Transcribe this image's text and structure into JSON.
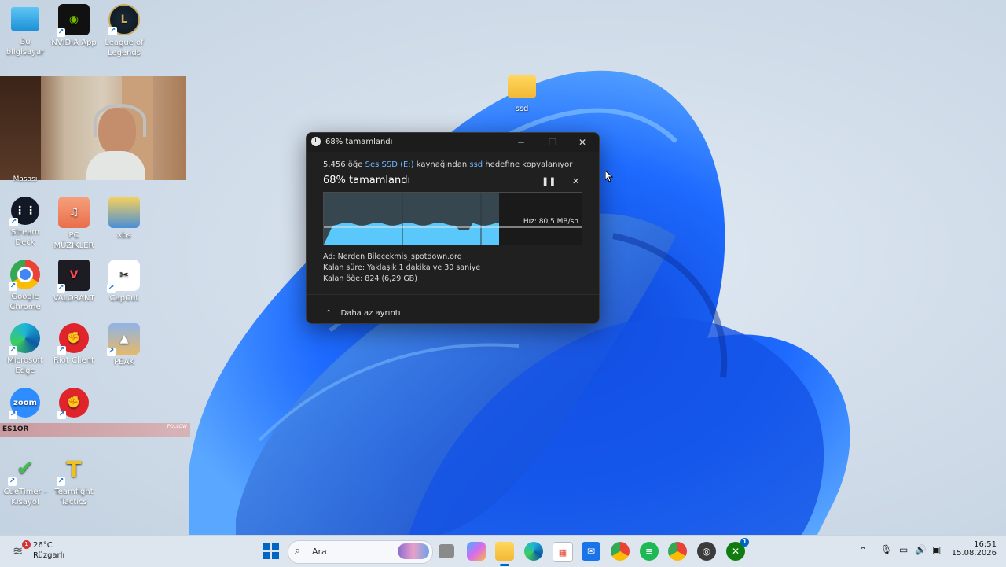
{
  "desktop": {
    "icons": [
      {
        "label": "Bu bilgisayar"
      },
      {
        "label": "NVIDIA App"
      },
      {
        "label": "League of Legends"
      },
      {
        "label": "Stream Deck"
      },
      {
        "label": "PC MÜZİKLER"
      },
      {
        "label": "xbs"
      },
      {
        "label": "Google Chrome"
      },
      {
        "label": "VALORANT"
      },
      {
        "label": "CapCut"
      },
      {
        "label": "Microsoft Edge"
      },
      {
        "label": "Riot Client"
      },
      {
        "label": "PEAK"
      },
      {
        "label": "CueTimer - Kısayol"
      },
      {
        "label": "Teamfight Tactics"
      },
      {
        "label": "ssd"
      }
    ],
    "partial_labels": {
      "masasi": "Masası",
      "zoom": "zoom"
    }
  },
  "overlay": {
    "streamer_name": "ES1OR",
    "follow_label": "FOLLOW"
  },
  "dialog": {
    "title": "68%  tamamlandı",
    "progress_percent": 68,
    "line_count": "5.456 öğe",
    "line_source": "Ses SSD (E:)",
    "line_mid": "kaynağından",
    "line_dest": "ssd",
    "line_end": "hedefine kopyalanıyor",
    "status": "68%  tamamlandı",
    "speed": "Hız: 80,5 MB/sn",
    "name": "Ad: Nerden Bilecekmiş_spotdown.org",
    "time_left": "Kalan süre: Yaklaşık 1 dakika ve 30 saniye",
    "items_left": "Kalan öğe: 824 (6,29 GB)",
    "less_details": "Daha az ayrıntı"
  },
  "taskbar": {
    "weather_temp": "26°C",
    "weather_desc": "Rüzgarlı",
    "weather_badge": "1",
    "search_placeholder": "Ara",
    "time": "16:51",
    "date": "15.08.2026",
    "xbox_badge": "1"
  },
  "colors": {
    "accent": "#1a73e8",
    "taskbar": "#dde6ef",
    "dialog_bg": "#202020",
    "graph_fill": "#5ac8fa"
  }
}
